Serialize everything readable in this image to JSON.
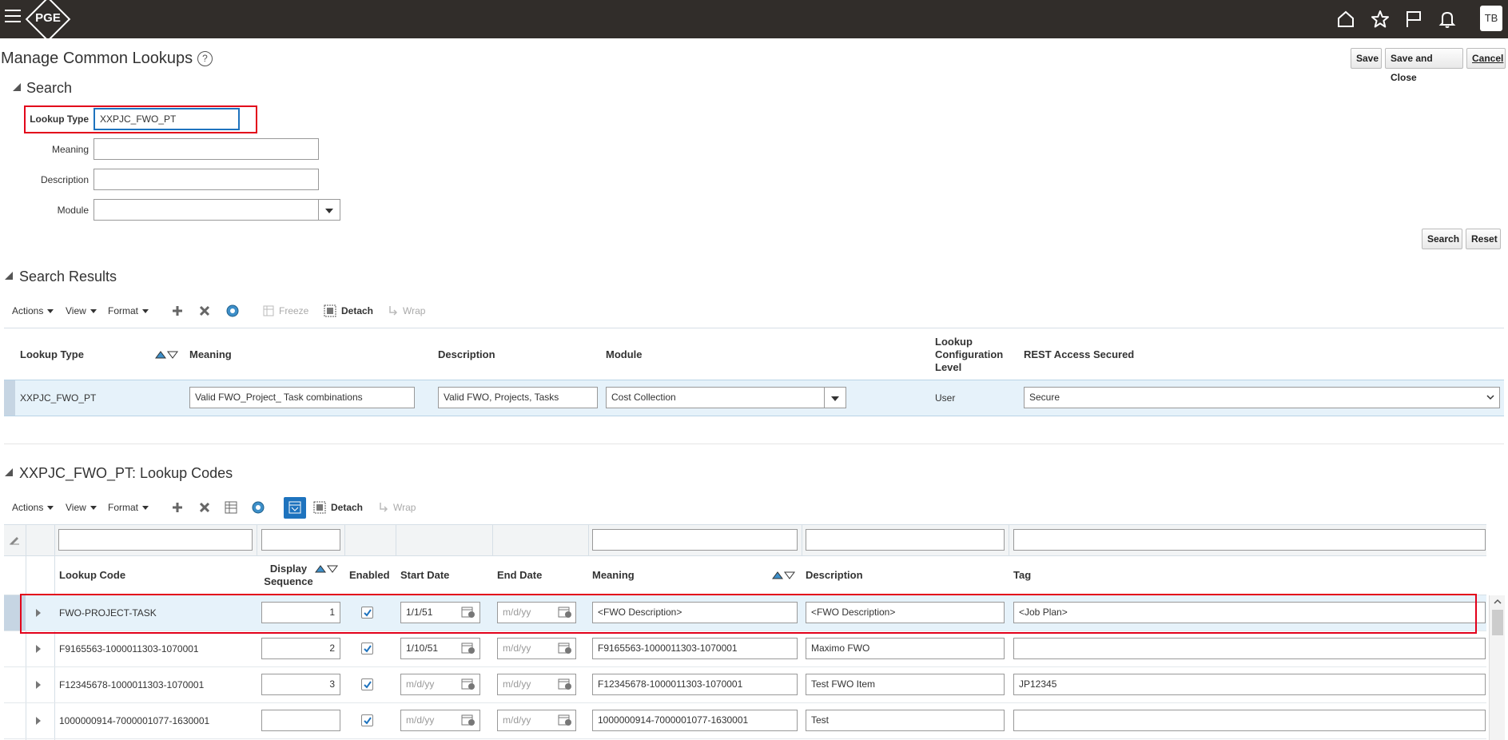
{
  "topbar": {
    "logo_text": "PGE",
    "avatar": "TB",
    "icons": [
      "home-icon",
      "star-icon",
      "flag-icon",
      "bell-icon"
    ]
  },
  "page": {
    "title": "Manage Common Lookups",
    "help_glyph": "?",
    "save": "Save",
    "save_close": "Save and Close",
    "cancel": "Cancel"
  },
  "search": {
    "title": "Search",
    "lookup_type_label": "Lookup Type",
    "lookup_type_value": "XXPJC_FWO_PT",
    "meaning_label": "Meaning",
    "description_label": "Description",
    "module_label": "Module",
    "search_button": "Search",
    "reset_button": "Reset"
  },
  "results": {
    "title": "Search Results",
    "toolbar": {
      "actions": "Actions",
      "view": "View",
      "format": "Format",
      "freeze": "Freeze",
      "detach": "Detach",
      "wrap": "Wrap"
    },
    "headers": {
      "lookup_type": "Lookup Type",
      "meaning": "Meaning",
      "description": "Description",
      "module": "Module",
      "config_level_1": "Lookup",
      "config_level_2": "Configuration",
      "config_level_3": "Level",
      "rest": "REST Access Secured"
    },
    "row": {
      "lookup_type": "XXPJC_FWO_PT",
      "meaning": "Valid FWO_Project_ Task combinations",
      "description": "Valid FWO, Projects, Tasks",
      "module": "Cost Collection",
      "config_level": "User",
      "rest": "Secure"
    }
  },
  "codes": {
    "title": "XXPJC_FWO_PT: Lookup Codes",
    "toolbar": {
      "actions": "Actions",
      "view": "View",
      "format": "Format",
      "detach": "Detach",
      "wrap": "Wrap"
    },
    "headers": {
      "lookup_code": "Lookup Code",
      "display_1": "Display",
      "display_2": "Sequence",
      "enabled": "Enabled",
      "start_date": "Start Date",
      "end_date": "End Date",
      "meaning": "Meaning",
      "description": "Description",
      "tag": "Tag"
    },
    "date_placeholder": "m/d/yy",
    "rows": [
      {
        "code": "FWO-PROJECT-TASK",
        "seq": "1",
        "enabled": true,
        "start": "1/1/51",
        "end": "",
        "meaning": "<FWO Description>",
        "description": "<FWO Description>",
        "tag": "<Job Plan>"
      },
      {
        "code": "F9165563-1000011303-1070001",
        "seq": "2",
        "enabled": true,
        "start": "1/10/51",
        "end": "",
        "meaning": "F9165563-1000011303-1070001",
        "description": "Maximo FWO",
        "tag": ""
      },
      {
        "code": "F12345678-1000011303-1070001",
        "seq": "3",
        "enabled": true,
        "start": "",
        "end": "",
        "meaning": "F12345678-1000011303-1070001",
        "description": "Test FWO Item",
        "tag": "JP12345"
      },
      {
        "code": "1000000914-7000001077-1630001",
        "seq": "",
        "enabled": true,
        "start": "",
        "end": "",
        "meaning": "1000000914-7000001077-1630001",
        "description": "Test",
        "tag": ""
      }
    ]
  },
  "colors": {
    "topbar": "#312d2a",
    "highlight": "#e2001a",
    "selected_row": "#e6f2fa",
    "accent": "#1e73be"
  }
}
